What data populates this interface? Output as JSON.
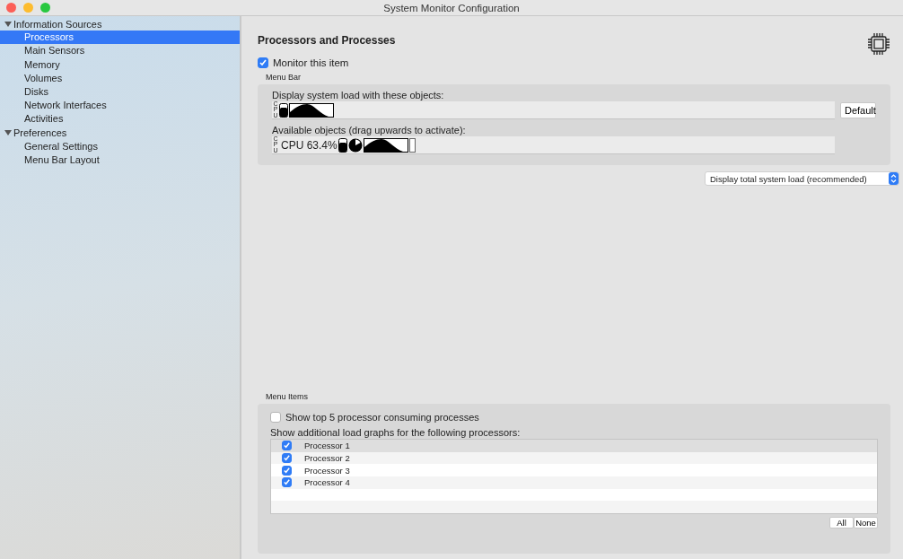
{
  "window": {
    "title": "System Monitor Configuration"
  },
  "sidebar": {
    "groups": [
      {
        "label": "Information Sources",
        "expanded": true,
        "children": [
          {
            "label": "Processors",
            "selected": true
          },
          {
            "label": "Main Sensors",
            "selected": false
          },
          {
            "label": "Memory",
            "selected": false
          },
          {
            "label": "Volumes",
            "selected": false
          },
          {
            "label": "Disks",
            "selected": false
          },
          {
            "label": "Network Interfaces",
            "selected": false
          },
          {
            "label": "Activities",
            "selected": false
          }
        ]
      },
      {
        "label": "Preferences",
        "expanded": true,
        "children": [
          {
            "label": "General Settings",
            "selected": false
          },
          {
            "label": "Menu Bar Layout",
            "selected": false
          }
        ]
      }
    ]
  },
  "content": {
    "title": "Processors and Processes",
    "monitor": {
      "label": "Monitor this item",
      "checked": true
    },
    "menu_bar": {
      "label": "Menu Bar",
      "display_label": "Display system load with these objects:",
      "display_objects": [
        {
          "kind": "label",
          "text": "CPU"
        },
        {
          "kind": "bar"
        },
        {
          "kind": "graph"
        }
      ],
      "default_button": "Default",
      "available_label": "Available objects (drag upwards to activate):",
      "available_objects": [
        {
          "kind": "label",
          "text": "CPU"
        },
        {
          "kind": "text",
          "text": "CPU 63.4%"
        },
        {
          "kind": "bar"
        },
        {
          "kind": "pie"
        },
        {
          "kind": "graph"
        },
        {
          "kind": "slot"
        }
      ],
      "mode_select": "Display total system load (recommended)"
    },
    "menu_items": {
      "label": "Menu Items",
      "top_processes": {
        "label": "Show top 5 processor consuming processes",
        "checked": false
      },
      "graphs_label": "Show additional load graphs for the following processors:",
      "processors": [
        {
          "label": "Processor 1",
          "checked": true,
          "selected": true
        },
        {
          "label": "Processor 2",
          "checked": true,
          "selected": false
        },
        {
          "label": "Processor 3",
          "checked": true,
          "selected": false
        },
        {
          "label": "Processor 4",
          "checked": true,
          "selected": false
        }
      ],
      "buttons": [
        "All",
        "None"
      ]
    }
  }
}
